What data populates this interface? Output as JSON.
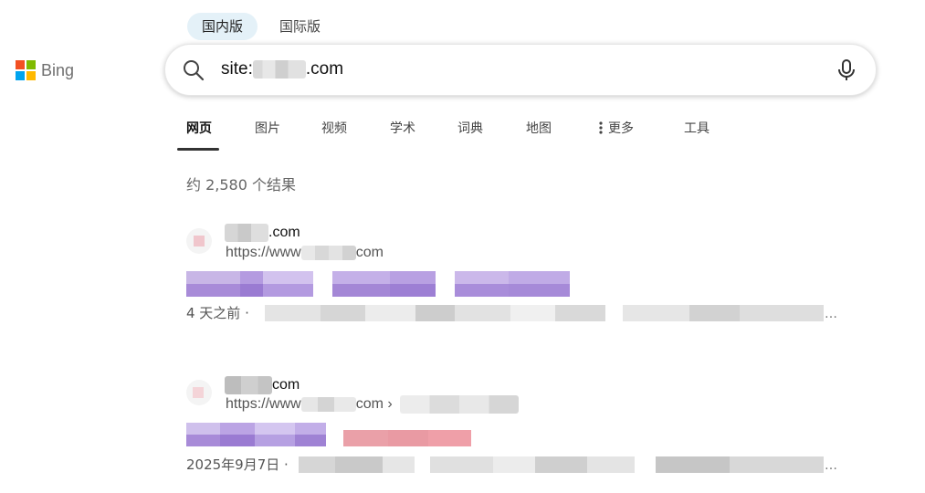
{
  "logo": {
    "text": "Bing"
  },
  "markets": [
    "国内版",
    "国际版"
  ],
  "search": {
    "prefix": "site:",
    "suffix": ".com"
  },
  "scopes": [
    "网页",
    "图片",
    "视频",
    "学术",
    "词典",
    "地图",
    "更多",
    "工具"
  ],
  "result_count": "约 2,580 个结果",
  "results": [
    {
      "site_suffix": ".com",
      "url_prefix": "https://www",
      "url_suffix": "com",
      "date": "4 天之前 ·",
      "ellipsis": "…"
    },
    {
      "site_suffix": "com",
      "url_prefix": "https://www",
      "url_suffix": "com ›",
      "date": "2025年9月7日 ·",
      "ellipsis": "…"
    }
  ],
  "colors": {
    "accent_tab": "#e4f1f8",
    "title_purple": "#9b7fd0",
    "title_pink": "#e89aa2"
  }
}
